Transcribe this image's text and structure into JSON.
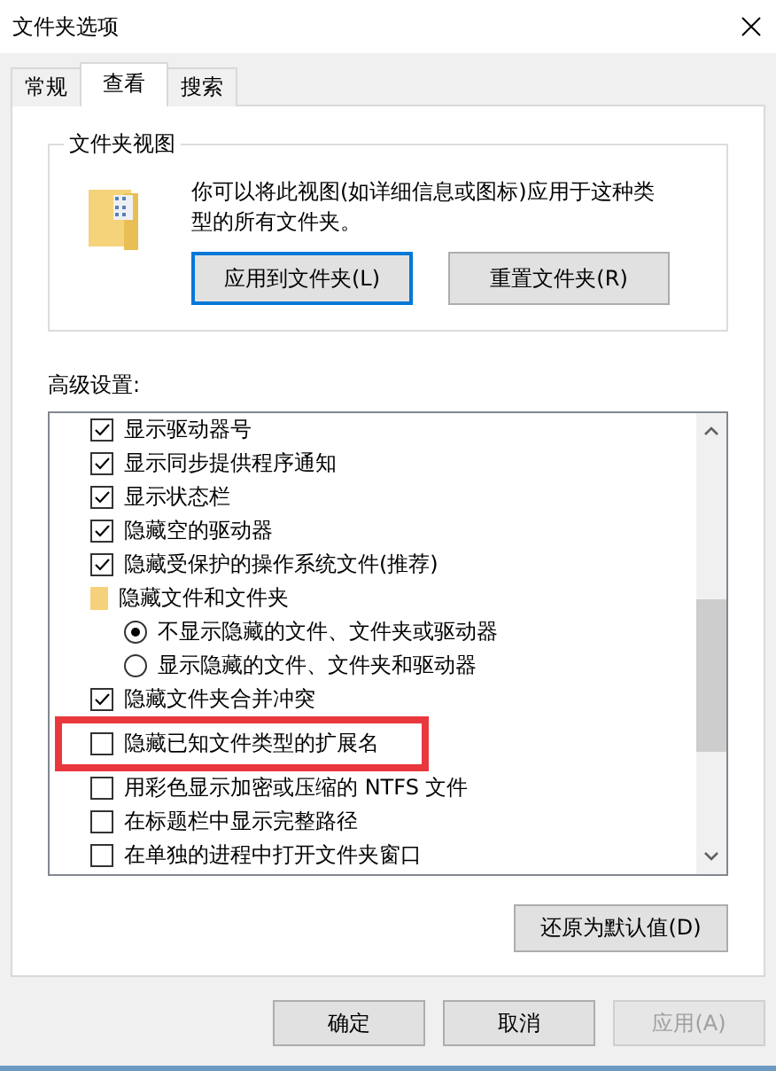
{
  "window": {
    "title": "文件夹选项"
  },
  "tabs": [
    {
      "label": "常规",
      "selected": false
    },
    {
      "label": "查看",
      "selected": true
    },
    {
      "label": "搜索",
      "selected": false
    }
  ],
  "folder_view": {
    "title": "文件夹视图",
    "description": "你可以将此视图(如详细信息或图标)应用于这种类型的所有文件夹。",
    "buttons": [
      {
        "label": "应用到文件夹(L)",
        "focused": true
      },
      {
        "label": "重置文件夹(R)",
        "focused": false
      }
    ]
  },
  "advanced": {
    "label": "高级设置:",
    "items": [
      {
        "kind": "checkbox",
        "label": "显示驱动器号",
        "checked": true,
        "highlighted": false
      },
      {
        "kind": "checkbox",
        "label": "显示同步提供程序通知",
        "checked": true,
        "highlighted": false
      },
      {
        "kind": "checkbox",
        "label": "显示状态栏",
        "checked": true,
        "highlighted": false
      },
      {
        "kind": "checkbox",
        "label": "隐藏空的驱动器",
        "checked": true,
        "highlighted": false
      },
      {
        "kind": "checkbox",
        "label": "隐藏受保护的操作系统文件(推荐)",
        "checked": true,
        "highlighted": false
      },
      {
        "kind": "folder",
        "label": "隐藏文件和文件夹",
        "highlighted": false
      },
      {
        "kind": "radio",
        "label": "不显示隐藏的文件、文件夹或驱动器",
        "selected": true,
        "highlighted": false
      },
      {
        "kind": "radio",
        "label": "显示隐藏的文件、文件夹和驱动器",
        "selected": false,
        "highlighted": false
      },
      {
        "kind": "checkbox",
        "label": "隐藏文件夹合并冲突",
        "checked": true,
        "highlighted": false
      },
      {
        "kind": "checkbox",
        "label": "隐藏已知文件类型的扩展名",
        "checked": false,
        "highlighted": true
      },
      {
        "kind": "checkbox",
        "label": "用彩色显示加密或压缩的 NTFS 文件",
        "checked": false,
        "highlighted": false
      },
      {
        "kind": "checkbox",
        "label": "在标题栏中显示完整路径",
        "checked": false,
        "highlighted": false
      },
      {
        "kind": "checkbox",
        "label": "在单独的进程中打开文件夹窗口",
        "checked": false,
        "highlighted": false
      }
    ],
    "restore_button": "还原为默认值(D)"
  },
  "buttons": [
    {
      "label": "确定",
      "disabled": false
    },
    {
      "label": "取消",
      "disabled": false
    },
    {
      "label": "应用(A)",
      "disabled": true
    }
  ]
}
